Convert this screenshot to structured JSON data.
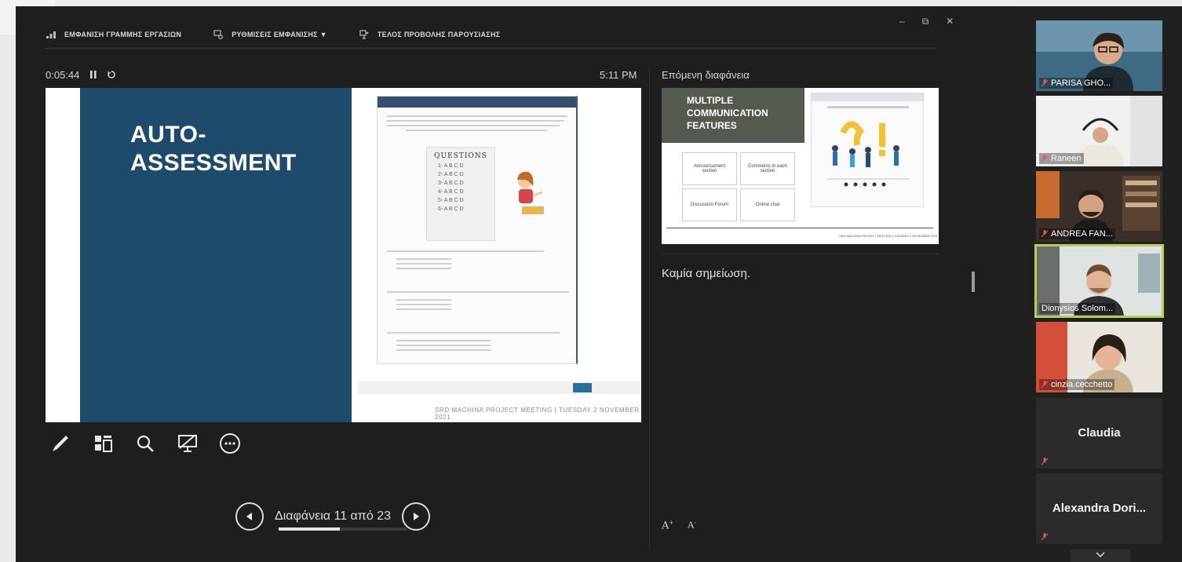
{
  "toolbar": {
    "show_taskbar": "ΕΜΦΑΝΙΣΗ ΓΡΑΜΜΗΣ ΕΡΓΑΣΙΩΝ",
    "display_settings": "ΡΥΘΜΙΣΕΙΣ ΕΜΦΑΝΙΣΗΣ ▼",
    "end_show": "ΤΕΛΟΣ ΠΡΟΒΟΛΗΣ ΠΑΡΟΥΣΙΑΣΗΣ"
  },
  "window_controls": {
    "minimize": "–",
    "restore": "⧉",
    "close": "✕"
  },
  "timer": {
    "elapsed": "0:05:44",
    "pause_icon": "pause-icon",
    "reset_icon": "reset-icon"
  },
  "clock": "5:11 PM",
  "current_slide": {
    "title_line1": "AUTO-",
    "title_line2": "ASSESSMENT",
    "questions_title": "QUESTIONS",
    "question_rows": [
      "1-  A B C D",
      "2-  A B C D",
      "3-  A B C D",
      "4-  A B C D",
      "5-  A B C D",
      "6-  A B C D"
    ],
    "footer": "SRD MACHINA PROJECT MEETING | TUESDAY 2 NOVEMBER 2021"
  },
  "navigation": {
    "slide_counter": "Διαφάνεια 11 από 23",
    "current": 11,
    "total": 23,
    "progress_fraction": 0.478
  },
  "next_slide": {
    "label": "Επόμενη διαφάνεια",
    "title": "MULTIPLE COMMUNICATION FEATURES",
    "boxes": [
      "Announcement section",
      "Comments in each section",
      "Discussion Forum",
      "Online chat"
    ]
  },
  "notes": {
    "text": "Καμία σημείωση."
  },
  "font_controls": {
    "increase": "A",
    "decrease": "A"
  },
  "participants": [
    {
      "name": "PARISA GHO..."
    },
    {
      "name": "Raneen"
    },
    {
      "name": "ANDREA FAN..."
    },
    {
      "name": "Dionysios Solom..."
    },
    {
      "name": "cinzia.cecchetto"
    },
    {
      "name": "Claudia"
    },
    {
      "name": "Alexandra Dori..."
    }
  ],
  "colors": {
    "active_speaker": "#b6cf59",
    "slide_panel": "#1e4a6b",
    "background": "#1e1e1e"
  }
}
